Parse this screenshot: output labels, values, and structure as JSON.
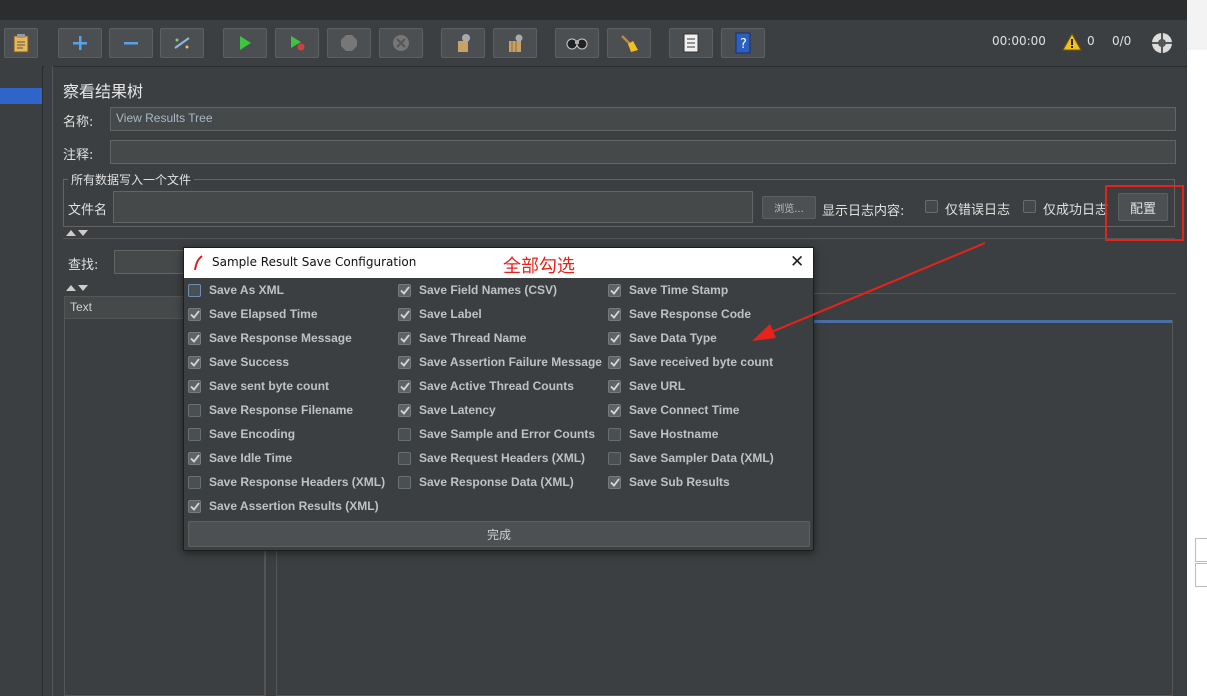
{
  "toolbar": {
    "timer": "00:00:00",
    "warning_count": "0",
    "thread_count": "0/0"
  },
  "panel": {
    "title": "察看结果树",
    "name_label": "名称:",
    "name_value": "View Results Tree",
    "comment_label": "注释:",
    "comment_value": "",
    "fieldset_legend": "所有数据写入一个文件",
    "filename_label": "文件名",
    "filename_value": "",
    "browse_button": "浏览...",
    "log_display_label": "显示日志内容:",
    "errors_only_label": "仅错误日志",
    "success_only_label": "仅成功日志",
    "configure_button": "配置",
    "search_label": "查找:",
    "text_column": "Text"
  },
  "dialog": {
    "title": "Sample Result Save Configuration",
    "annotation": "全部勾选",
    "done_button": "完成",
    "col1": [
      {
        "label": "Save As XML",
        "checked": false,
        "focus": true
      },
      {
        "label": "Save Elapsed Time",
        "checked": true
      },
      {
        "label": "Save Response Message",
        "checked": true
      },
      {
        "label": "Save Success",
        "checked": true
      },
      {
        "label": "Save sent byte count",
        "checked": true
      },
      {
        "label": "Save Response Filename",
        "checked": false
      },
      {
        "label": "Save Encoding",
        "checked": false
      },
      {
        "label": "Save Idle Time",
        "checked": true
      },
      {
        "label": "Save Response Headers (XML)",
        "checked": false
      },
      {
        "label": "Save Assertion Results (XML)",
        "checked": true
      }
    ],
    "col2": [
      {
        "label": "Save Field Names (CSV)",
        "checked": true
      },
      {
        "label": "Save Label",
        "checked": true
      },
      {
        "label": "Save Thread Name",
        "checked": true
      },
      {
        "label": "Save Assertion Failure Message",
        "checked": true
      },
      {
        "label": "Save Active Thread Counts",
        "checked": true
      },
      {
        "label": "Save Latency",
        "checked": true
      },
      {
        "label": "Save Sample and Error Counts",
        "checked": false
      },
      {
        "label": "Save Request Headers (XML)",
        "checked": false
      },
      {
        "label": "Save Response Data (XML)",
        "checked": false
      }
    ],
    "col3": [
      {
        "label": "Save Time Stamp",
        "checked": true
      },
      {
        "label": "Save Response Code",
        "checked": true
      },
      {
        "label": "Save Data Type",
        "checked": true
      },
      {
        "label": "Save received byte count",
        "checked": true
      },
      {
        "label": "Save URL",
        "checked": true
      },
      {
        "label": "Save Connect Time",
        "checked": true
      },
      {
        "label": "Save Hostname",
        "checked": false
      },
      {
        "label": "Save Sampler Data (XML)",
        "checked": false
      },
      {
        "label": "Save Sub Results",
        "checked": true
      }
    ]
  },
  "colors": {
    "annotation": "#e8221b",
    "selection": "#2f65ca",
    "background": "#3c3f41"
  }
}
